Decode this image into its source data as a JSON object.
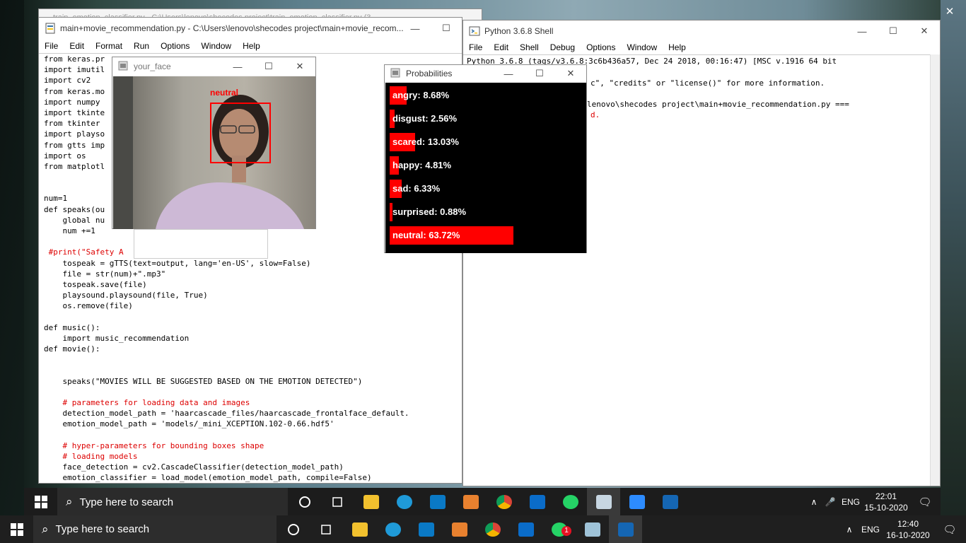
{
  "outer_taskbar": {
    "search_placeholder": "Type here to search",
    "lang": "ENG",
    "time": "12:40",
    "date": "16-10-2020",
    "badge": "1"
  },
  "inner_taskbar": {
    "search_placeholder": "Type here to search",
    "lang": "ENG",
    "time": "22:01",
    "date": "15-10-2020"
  },
  "bg_window": {
    "title": "train_emotion_classifier.py - C:\\Users\\lenovo\\shecodes project\\train_emotion_classifier.py (3..."
  },
  "editor": {
    "title": "main+movie_recommendation.py - C:\\Users\\lenovo\\shecodes project\\main+movie_recom...",
    "menu": [
      "File",
      "Edit",
      "Format",
      "Run",
      "Options",
      "Window",
      "Help"
    ],
    "lines": [
      "from keras.pr",
      "import imutil",
      "import cv2",
      "from keras.mo",
      "import numpy",
      "import tkinte",
      "from tkinter",
      "import playso",
      "from gtts imp",
      "import os",
      "from matplotl",
      "",
      "",
      "num=1",
      "def speaks(ou",
      "    global nu",
      "    num +=1",
      "",
      " #print(\"Safety A",
      "    tospeak = gTTS(text=output, lang='en-US', slow=False)",
      "    file = str(num)+\".mp3\"",
      "    tospeak.save(file)",
      "    playsound.playsound(file, True)",
      "    os.remove(file)",
      "",
      "def music():",
      "    import music_recommendation",
      "def movie():",
      "",
      "",
      "    speaks(\"MOVIES WILL BE SUGGESTED BASED ON THE EMOTION DETECTED\")",
      "",
      "    # parameters for loading data and images",
      "    detection_model_path = 'haarcascade_files/haarcascade_frontalface_default.",
      "    emotion_model_path = 'models/_mini_XCEPTION.102-0.66.hdf5'",
      "",
      "    # hyper-parameters for bounding boxes shape",
      "    # loading models",
      "    face_detection = cv2.CascadeClassifier(detection_model_path)",
      "    emotion_classifier = load_model(emotion_model_path, compile=False)"
    ]
  },
  "shell": {
    "title": "Python 3.6.8 Shell",
    "menu": [
      "File",
      "Edit",
      "Shell",
      "Debug",
      "Options",
      "Window",
      "Help"
    ],
    "line1": "Python 3.6.8 (tags/v3.6.8:3c6b436a57, Dec 24 2018, 00:16:47) [MSC v.1916 64 bit",
    "line2": "c\", \"credits\" or \"license()\" for more information.",
    "line3": "lenovo\\shecodes project\\main+movie_recommendation.py ===",
    "line4": "d."
  },
  "face": {
    "title": "your_face",
    "label": "neutral"
  },
  "prob": {
    "title": "Probabilities",
    "items": [
      {
        "label": "angry: 8.68%",
        "fraction": 0.0868
      },
      {
        "label": "disgust: 2.56%",
        "fraction": 0.0256
      },
      {
        "label": "scared: 13.03%",
        "fraction": 0.1303
      },
      {
        "label": "happy: 4.81%",
        "fraction": 0.0481
      },
      {
        "label": "sad: 6.33%",
        "fraction": 0.0633
      },
      {
        "label": "surprised: 0.88%",
        "fraction": 0.0088
      },
      {
        "label": "neutral: 63.72%",
        "fraction": 0.6372
      }
    ]
  },
  "colors": {
    "bar": "#ff0000",
    "taskbar": "#1f1f1f",
    "accent": "#0078d7"
  }
}
